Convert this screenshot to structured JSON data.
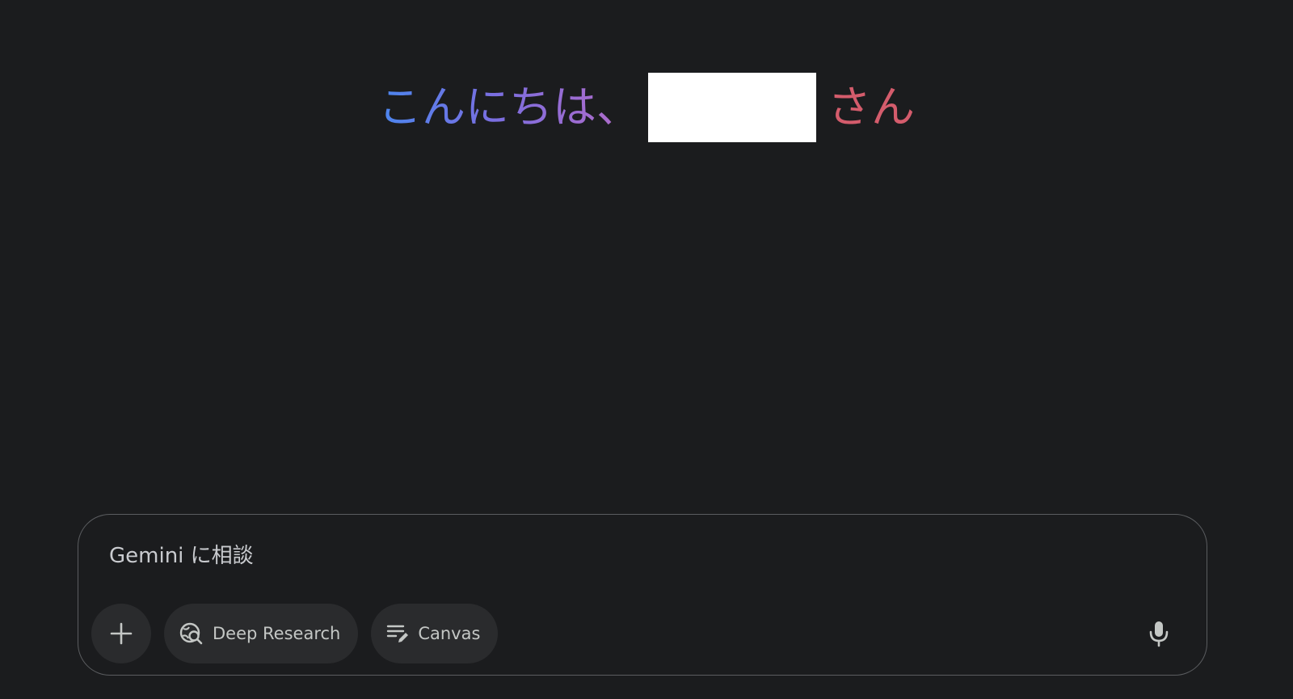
{
  "greeting": {
    "prefix": "こんにちは、",
    "name_redacted": "",
    "suffix": "さん"
  },
  "composer": {
    "placeholder": "Gemini に相談",
    "tools": [
      {
        "label": "",
        "icon": "plus-icon"
      },
      {
        "label": "Deep Research",
        "icon": "deep-research-icon"
      },
      {
        "label": "Canvas",
        "icon": "canvas-icon"
      }
    ],
    "mic_icon": "microphone-icon"
  },
  "colors": {
    "background": "#1b1c1e",
    "greeting_start": "#4b86ee",
    "greeting_mid": "#b66bc6",
    "greeting_suffix": "#d45c6c",
    "pill_bg": "#2a2b2d",
    "text": "#c4c7c5",
    "composer_border": "#5b5d60"
  }
}
